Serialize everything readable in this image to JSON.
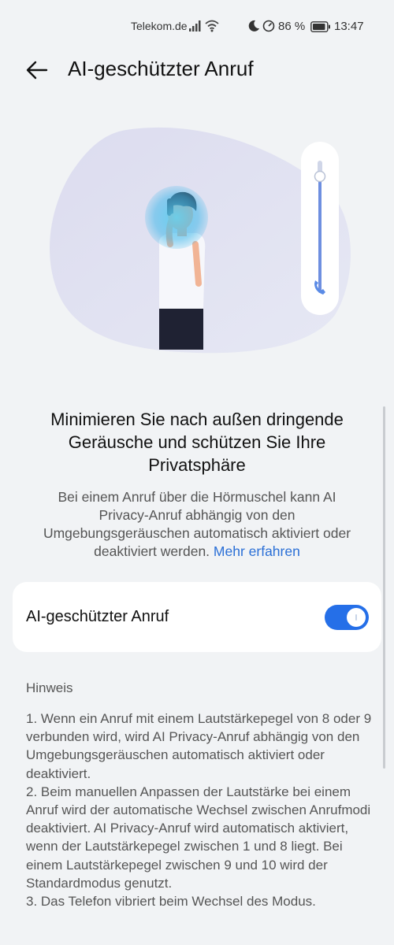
{
  "status_bar": {
    "carrier": "Telekom.de",
    "battery": "86 %",
    "time": "13:47",
    "icons": [
      "signal-icon",
      "wifi-icon",
      "moon-icon",
      "gauge-icon",
      "battery-icon"
    ]
  },
  "header": {
    "title": "AI-geschützter Anruf",
    "back_icon": "arrow-left-icon"
  },
  "intro": {
    "headline": "Minimieren Sie nach außen dringende Geräusche und schützen Sie Ihre Privatsphäre",
    "description": "Bei einem Anruf über die Hörmuschel kann AI Privacy-Anruf abhängig von den Umgebungsgeräuschen automatisch aktiviert oder deaktiviert werden.",
    "link": "Mehr erfahren"
  },
  "setting": {
    "label": "AI-geschützter Anruf",
    "enabled": true,
    "accent_color": "#256fe8"
  },
  "notes": {
    "title": "Hinweis",
    "items": [
      "1. Wenn ein Anruf mit einem Lautstärkepegel von 8 oder 9 verbunden wird, wird AI Privacy-Anruf abhängig von den Umgebungsgeräuschen automatisch aktiviert oder deaktiviert.",
      "2. Beim manuellen Anpassen der Lautstärke bei einem Anruf wird der automatische Wechsel zwischen Anrufmodi deaktiviert. AI Privacy-Anruf wird automatisch aktiviert, wenn der Lautstärkepegel zwischen 1 und 8 liegt. Bei einem Lautstärkepegel zwischen 9 und 10 wird der Standardmodus genutzt.",
      "3. Das Telefon vibriert beim Wechsel des Modus."
    ]
  }
}
